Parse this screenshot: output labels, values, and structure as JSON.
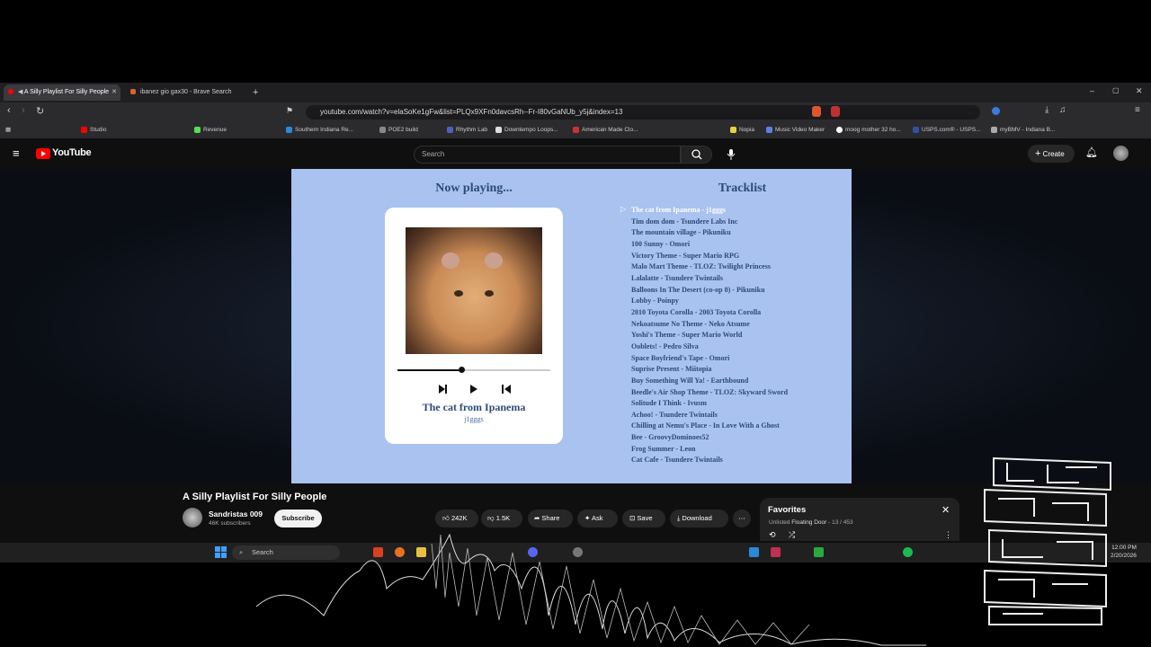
{
  "browser": {
    "tabs": [
      {
        "title": "A Silly Playlist For Silly People",
        "active": true
      },
      {
        "title": "ibanez gio gax30 - Brave Search",
        "active": false
      }
    ],
    "url": "youtube.com/watch?v=elaSoKe1gFw&list=PLQx9XFn0davcsRh--Fr-I80vGaNUb_y5j&index=13",
    "bookmarks": [
      "Studio",
      "Revenue",
      "Southern Indiana Re...",
      "POE2 build",
      "Rhythm Lab",
      "Downtempo Loops...",
      "American Made Clo...",
      "Nopia",
      "Music Video Maker",
      "moog mother 32 ho...",
      "USPS.com® - USPS...",
      "myBMV - Indiana B..."
    ]
  },
  "youtube": {
    "logo_text": "YouTube",
    "search_placeholder": "Search",
    "create_label": "Create"
  },
  "video": {
    "now_playing_heading": "Now playing...",
    "tracklist_heading": "Tracklist",
    "song_title": "The cat from Ipanema",
    "song_artist": "j1gggs",
    "progress": 0.42,
    "tracks": [
      "The cat from Ipanema - j1gggs",
      "Tim dom dom - Tsundere Labs Inc",
      "The mountain village - Pikuniku",
      "100 Sunny - Omori",
      "Victory Theme - Super Mario RPG",
      "Malo Mart Theme - TLOZ: Twilight Princess",
      "Lalalatte - Tsundere Twintails",
      "Balloons In The Desert (co-op 8) - Pikuniku",
      "Lobby - Poinpy",
      "2010 Toyota Corolla - 2003 Toyota Corolla",
      "Nekoatsume No Theme - Neko Atsume",
      "Yoshi's Theme - Super Mario World",
      "Ooblets! - Pedro Silva",
      "Space Boyfriend's Tape - Omori",
      "Suprise Present - Miitopia",
      "Buy Something Will Ya! - Earthbound",
      "Beedle's Air Shop Theme - TLOZ: Skyward Sword",
      "Solitude I Think - Ivusm",
      "Achoo! - Tsundere Twintails",
      "Chilling at Nemu's Place - In Love With a Ghost",
      "Bee - GroovyDominoes52",
      "Frog Summer - Leon",
      "Cat Cafe - Tsundere Twintails"
    ]
  },
  "below_video": {
    "title": "A Silly Playlist For Silly People",
    "channel": "Sandristas 009",
    "subscribers": "46K subscribers",
    "subscribe_label": "Subscribe",
    "likes": "242K",
    "dislikes": "1.5K",
    "share_label": "Share",
    "ask_label": "Ask",
    "save_label": "Save",
    "download_label": "Download"
  },
  "playlist_panel": {
    "title": "Favorites",
    "status": "Unlisted",
    "owner": "Floating Door",
    "position": "- 13 / 453"
  },
  "taskbar": {
    "search_label": "Search",
    "time": "12:00 PM",
    "date": "2/20/2026"
  },
  "colors": {
    "video_bg": "#a9c2ef",
    "title_blue": "#2c4a7a",
    "youtube_red": "#ff0000"
  }
}
